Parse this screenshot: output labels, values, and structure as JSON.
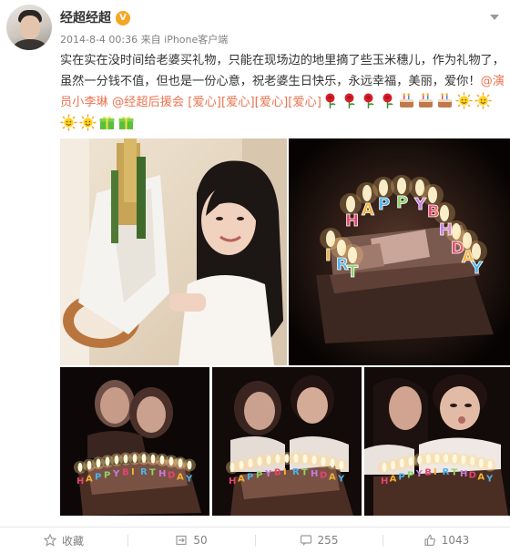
{
  "post": {
    "author": "经超经超",
    "verified_badge": "V",
    "timestamp": "2014-8-4 00:36",
    "source_prefix": "来自",
    "source": "iPhone客户端",
    "text_intro": "实在实在没时间给老婆买礼物，只能在现场边的地里摘了些玉米穗儿，作为礼物了，虽然一分钱不值，但也是一份心意，祝老婆生日快乐，永远幸福，美丽，爱你！",
    "mention_1": "@演员小李琳",
    "mention_2": "@经超后援会",
    "emoticon_text": "[爱心][爱心][爱心][爱心]",
    "emoticons": [
      "rose-icon",
      "rose-icon",
      "rose-icon",
      "rose-icon",
      "cake-icon",
      "cake-icon",
      "cake-icon",
      "sun-icon",
      "sun-icon",
      "sun-icon",
      "sun-icon",
      "gift-icon",
      "gift-icon"
    ],
    "photos": [
      {
        "name": "photo-woman-with-bouquet"
      },
      {
        "name": "photo-birthday-cake"
      },
      {
        "name": "photo-couple-1"
      },
      {
        "name": "photo-couple-2"
      },
      {
        "name": "photo-couple-3"
      }
    ],
    "cake_letters": [
      "H",
      "A",
      "P",
      "P",
      "Y",
      "B",
      "I",
      "R",
      "T",
      "H",
      "D",
      "A",
      "Y"
    ]
  },
  "actions": {
    "favorite_label": "收藏",
    "repost_count": "50",
    "comment_count": "255",
    "like_count": "1043"
  },
  "colors": {
    "link": "#eb7350",
    "badge": "#f6a623",
    "meta": "#808080",
    "text": "#333333"
  }
}
